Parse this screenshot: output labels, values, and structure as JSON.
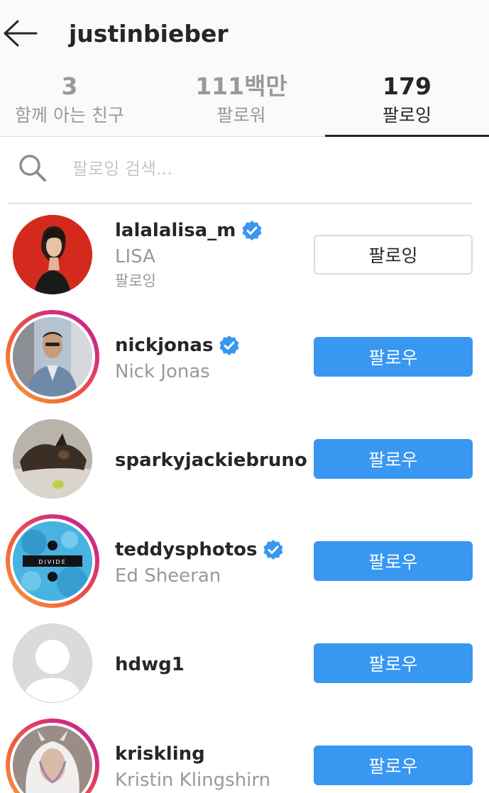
{
  "header": {
    "title": "justinbieber",
    "back_icon": "arrow-left-icon"
  },
  "tabs": [
    {
      "count": "3",
      "label": "함께 아는 친구",
      "active": false
    },
    {
      "count": "111백만",
      "label": "팔로워",
      "active": false
    },
    {
      "count": "179",
      "label": "팔로잉",
      "active": true
    }
  ],
  "search": {
    "placeholder": "팔로잉 검색...",
    "value": "",
    "icon": "search-icon"
  },
  "accounts": [
    {
      "username": "lalalalisa_m",
      "full_name": "LISA",
      "note": "팔로잉",
      "verified": true,
      "story_ring": false,
      "button_label": "팔로잉",
      "button_style": "following"
    },
    {
      "username": "nickjonas",
      "full_name": "Nick Jonas",
      "note": "",
      "verified": true,
      "story_ring": true,
      "button_label": "팔로우",
      "button_style": "follow"
    },
    {
      "username": "sparkyjackiebruno",
      "full_name": "",
      "note": "",
      "verified": false,
      "story_ring": false,
      "button_label": "팔로우",
      "button_style": "follow"
    },
    {
      "username": "teddysphotos",
      "full_name": "Ed Sheeran",
      "note": "",
      "verified": true,
      "story_ring": true,
      "button_label": "팔로우",
      "button_style": "follow",
      "avatar_text": "DIVIDE"
    },
    {
      "username": "hdwg1",
      "full_name": "",
      "note": "",
      "verified": false,
      "story_ring": false,
      "button_label": "팔로우",
      "button_style": "follow"
    },
    {
      "username": "kriskling",
      "full_name": "Kristin Klingshirn",
      "note": "",
      "verified": false,
      "story_ring": true,
      "button_label": "팔로우",
      "button_style": "follow"
    }
  ],
  "colors": {
    "accent_blue": "#3897f0",
    "verified_blue": "#3897f0",
    "text_primary": "#262626",
    "text_secondary": "#999999"
  }
}
